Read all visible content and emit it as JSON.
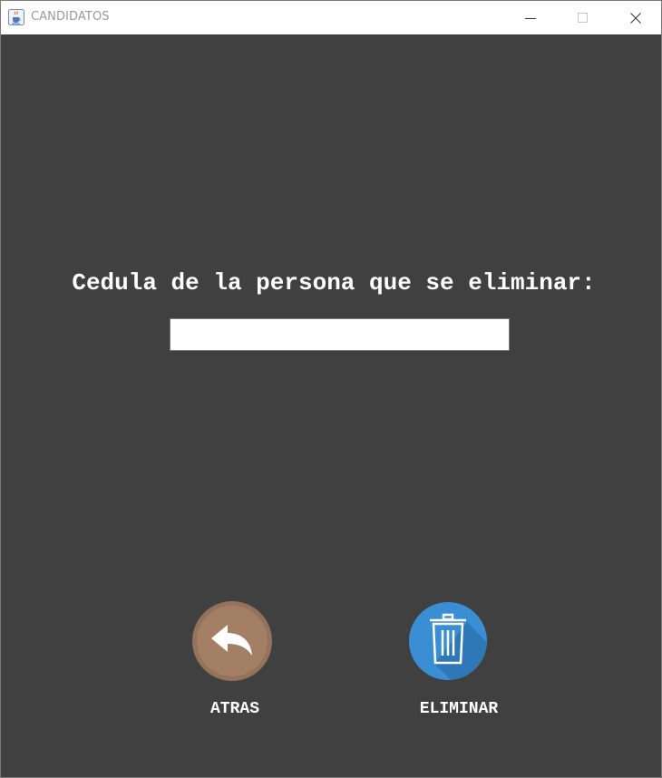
{
  "window": {
    "title": "CANDIDATOS",
    "icon": "java-cup-icon",
    "controls": [
      "minimize-icon",
      "maximize-icon",
      "close-icon"
    ]
  },
  "form": {
    "prompt": "Cedula de la persona que se eliminar:",
    "cedula_value": ""
  },
  "actions": {
    "back_label": "ATRAS",
    "back_icon": "undo-arrow-icon",
    "delete_label": "ELIMINAR",
    "delete_icon": "trash-icon"
  },
  "colors": {
    "background": "#404040",
    "back_button": "#a37f65",
    "delete_button": "#3a8fd4"
  }
}
